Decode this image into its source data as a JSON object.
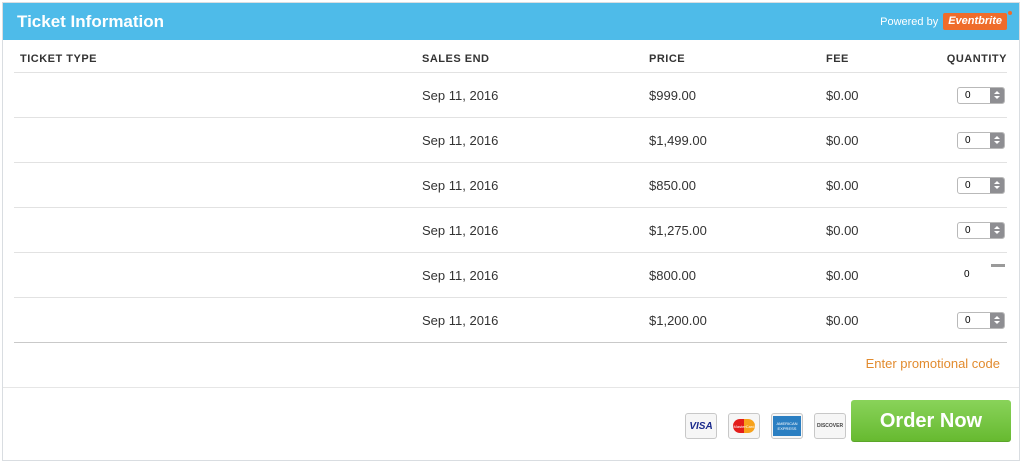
{
  "header": {
    "title": "Ticket Information",
    "powered_by": "Powered by",
    "brand": "Eventbrite"
  },
  "table": {
    "columns": [
      "TICKET TYPE",
      "SALES END",
      "PRICE",
      "FEE",
      "QUANTITY"
    ],
    "rows": [
      {
        "ticket_type": "",
        "sales_end": "Sep 11, 2016",
        "price": "$999.00",
        "fee": "$0.00",
        "quantity": "0"
      },
      {
        "ticket_type": "",
        "sales_end": "Sep 11, 2016",
        "price": "$1,499.00",
        "fee": "$0.00",
        "quantity": "0"
      },
      {
        "ticket_type": "",
        "sales_end": "Sep 11, 2016",
        "price": "$850.00",
        "fee": "$0.00",
        "quantity": "0"
      },
      {
        "ticket_type": "",
        "sales_end": "Sep 11, 2016",
        "price": "$1,275.00",
        "fee": "$0.00",
        "quantity": "0"
      },
      {
        "ticket_type": "",
        "sales_end": "Sep 11, 2016",
        "price": "$800.00",
        "fee": "$0.00",
        "quantity": "0"
      },
      {
        "ticket_type": "",
        "sales_end": "Sep 11, 2016",
        "price": "$1,200.00",
        "fee": "$0.00",
        "quantity": "0"
      }
    ]
  },
  "promo_link": "Enter promotional code",
  "footer": {
    "cards": [
      {
        "icon": "visa-card-icon",
        "label": "VISA"
      },
      {
        "icon": "mastercard-icon",
        "label": "MasterCard"
      },
      {
        "icon": "amex-card-icon",
        "label": "AMERICAN EXPRESS"
      },
      {
        "icon": "discover-card-icon",
        "label": "DISCOVER"
      }
    ],
    "order_button": "Order Now"
  },
  "colors": {
    "header_bg": "#4ebbe9",
    "brand_orange": "#ef6c2b",
    "promo_link": "#e28b2e",
    "order_button": "#76c442"
  }
}
